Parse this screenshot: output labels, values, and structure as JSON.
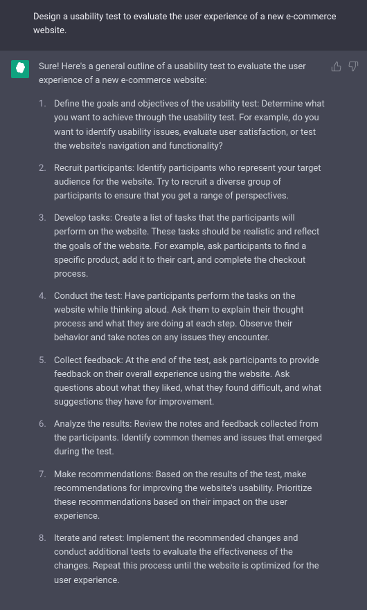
{
  "user": {
    "prompt": "Design a usability test to evaluate the user experience of a new e-commerce website."
  },
  "assistant": {
    "intro": "Sure! Here's a general outline of a usability test to evaluate the user experience of a new e-commerce website:",
    "steps": [
      "Define the goals and objectives of the usability test: Determine what you want to achieve through the usability test. For example, do you want to identify usability issues, evaluate user satisfaction, or test the website's navigation and functionality?",
      "Recruit participants: Identify participants who represent your target audience for the website. Try to recruit a diverse group of participants to ensure that you get a range of perspectives.",
      "Develop tasks: Create a list of tasks that the participants will perform on the website. These tasks should be realistic and reflect the goals of the website. For example, ask participants to find a specific product, add it to their cart, and complete the checkout process.",
      "Conduct the test: Have participants perform the tasks on the website while thinking aloud. Ask them to explain their thought process and what they are doing at each step. Observe their behavior and take notes on any issues they encounter.",
      "Collect feedback: At the end of the test, ask participants to provide feedback on their overall experience using the website. Ask questions about what they liked, what they found difficult, and what suggestions they have for improvement.",
      "Analyze the results: Review the notes and feedback collected from the participants. Identify common themes and issues that emerged during the test.",
      "Make recommendations: Based on the results of the test, make recommendations for improving the website's usability. Prioritize these recommendations based on their impact on the user experience.",
      "Iterate and retest: Implement the recommended changes and conduct additional tests to evaluate the effectiveness of the changes. Repeat this process until the website is optimized for the user experience."
    ]
  }
}
